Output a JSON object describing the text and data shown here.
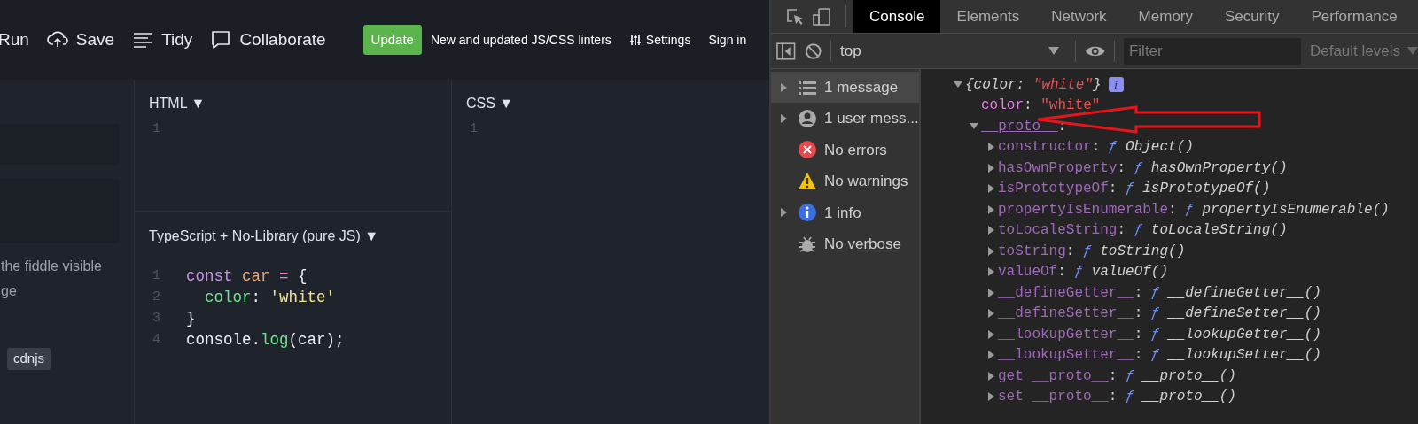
{
  "toolbar": {
    "actions": [
      {
        "kind": "run",
        "label": "Run"
      },
      {
        "kind": "save",
        "label": "Save"
      },
      {
        "kind": "tidy",
        "label": "Tidy"
      },
      {
        "kind": "collaborate",
        "label": "Collaborate"
      }
    ],
    "update_badge": "Update",
    "announcement": "New and updated JS/CSS linters",
    "settings": "Settings",
    "sign_in": "Sign in"
  },
  "sidebar": {
    "text_lines": [
      "the fiddle visible",
      "ge"
    ],
    "tag": "cdnjs"
  },
  "panels": [
    {
      "title": "HTML",
      "toggle": "▼",
      "lines": [
        {
          "number": "1"
        }
      ]
    },
    {
      "title": "TypeScript + No-Library (pure JS)",
      "toggle": "▼",
      "lines": [
        {
          "number": "1",
          "tokens": [
            {
              "kind": "keyword",
              "text": "const "
            },
            {
              "kind": "variable",
              "text": "car "
            },
            {
              "kind": "operator",
              "text": "= "
            },
            {
              "kind": "plain",
              "text": "{"
            }
          ]
        },
        {
          "number": "2",
          "indent": true,
          "tokens": [
            {
              "kind": "property",
              "text": "color"
            },
            {
              "kind": "plain",
              "text": ": "
            },
            {
              "kind": "string",
              "text": "'white'"
            }
          ]
        },
        {
          "number": "3",
          "tokens": [
            {
              "kind": "plain",
              "text": "}"
            }
          ]
        },
        {
          "number": "4",
          "tokens": [
            {
              "kind": "plain",
              "text": "console."
            },
            {
              "kind": "function",
              "text": "log"
            },
            {
              "kind": "plain",
              "text": "(car);"
            }
          ]
        }
      ]
    },
    {
      "title": "CSS",
      "toggle": "▼",
      "lines": [
        {
          "number": "1"
        }
      ]
    }
  ],
  "devtools": {
    "tabs": [
      {
        "label": "Console",
        "selected": true
      },
      {
        "label": "Elements",
        "selected": false
      },
      {
        "label": "Network",
        "selected": false
      },
      {
        "label": "Memory",
        "selected": false
      },
      {
        "label": "Security",
        "selected": false
      },
      {
        "label": "Performance",
        "selected": false
      }
    ],
    "context": "top",
    "filter": {
      "placeholder": "Filter"
    },
    "levels": "Default levels",
    "sidebar": [
      {
        "kind": "messages",
        "label": "1 message",
        "expandable": true,
        "selected": true
      },
      {
        "kind": "user",
        "label": "1 user mess...",
        "expandable": true,
        "selected": false
      },
      {
        "kind": "errors",
        "label": "No errors",
        "expandable": false,
        "selected": false
      },
      {
        "kind": "warnings",
        "label": "No warnings",
        "expandable": false,
        "selected": false
      },
      {
        "kind": "info",
        "label": "1 info",
        "expandable": true,
        "selected": false
      },
      {
        "kind": "verbose",
        "label": "No verbose",
        "expandable": false,
        "selected": false
      }
    ],
    "log": {
      "expanded": true,
      "open": "{color: ",
      "preview_value": "\"white\"",
      "close": "}",
      "info_badge": "i",
      "children": [
        {
          "key": "color",
          "separator": ":",
          "value": "\"white\"",
          "kind": "string"
        },
        {
          "key": "__proto__",
          "separator": ":",
          "expanded": true,
          "children": [
            {
              "key": "constructor",
              "separator": ":",
              "fn": "ƒ",
              "value": "Object()",
              "kind": "function",
              "expanded": false
            },
            {
              "key": "hasOwnProperty",
              "separator": ":",
              "fn": "ƒ",
              "value": "hasOwnProperty()",
              "kind": "function",
              "expanded": false
            },
            {
              "key": "isPrototypeOf",
              "separator": ":",
              "fn": "ƒ",
              "value": "isPrototypeOf()",
              "kind": "function",
              "expanded": false
            },
            {
              "key": "propertyIsEnumerable",
              "separator": ":",
              "fn": "ƒ",
              "value": "propertyIsEnumerable()",
              "kind": "function",
              "expanded": false
            },
            {
              "key": "toLocaleString",
              "separator": ":",
              "fn": "ƒ",
              "value": "toLocaleString()",
              "kind": "function",
              "expanded": false
            },
            {
              "key": "toString",
              "separator": ":",
              "fn": "ƒ",
              "value": "toString()",
              "kind": "function",
              "expanded": false
            },
            {
              "key": "valueOf",
              "separator": ":",
              "fn": "ƒ",
              "value": "valueOf()",
              "kind": "function",
              "expanded": false
            },
            {
              "key": "__defineGetter__",
              "separator": ":",
              "fn": "ƒ",
              "value": "__defineGetter__()",
              "kind": "function",
              "expanded": false
            },
            {
              "key": "__defineSetter__",
              "separator": ":",
              "fn": "ƒ",
              "value": "__defineSetter__()",
              "kind": "function",
              "expanded": false
            },
            {
              "key": "__lookupGetter__",
              "separator": ":",
              "fn": "ƒ",
              "value": "__lookupGetter__()",
              "kind": "function",
              "expanded": false
            },
            {
              "key": "__lookupSetter__",
              "separator": ":",
              "fn": "ƒ",
              "value": "__lookupSetter__()",
              "kind": "function",
              "expanded": false
            },
            {
              "key": "get __proto__",
              "separator": ":",
              "fn": "ƒ",
              "value": "__proto__()",
              "kind": "function",
              "expanded": false
            },
            {
              "key": "set __proto__",
              "separator": ":",
              "fn": "ƒ",
              "value": "__proto__()",
              "kind": "function",
              "expanded": false
            }
          ]
        }
      ]
    }
  }
}
